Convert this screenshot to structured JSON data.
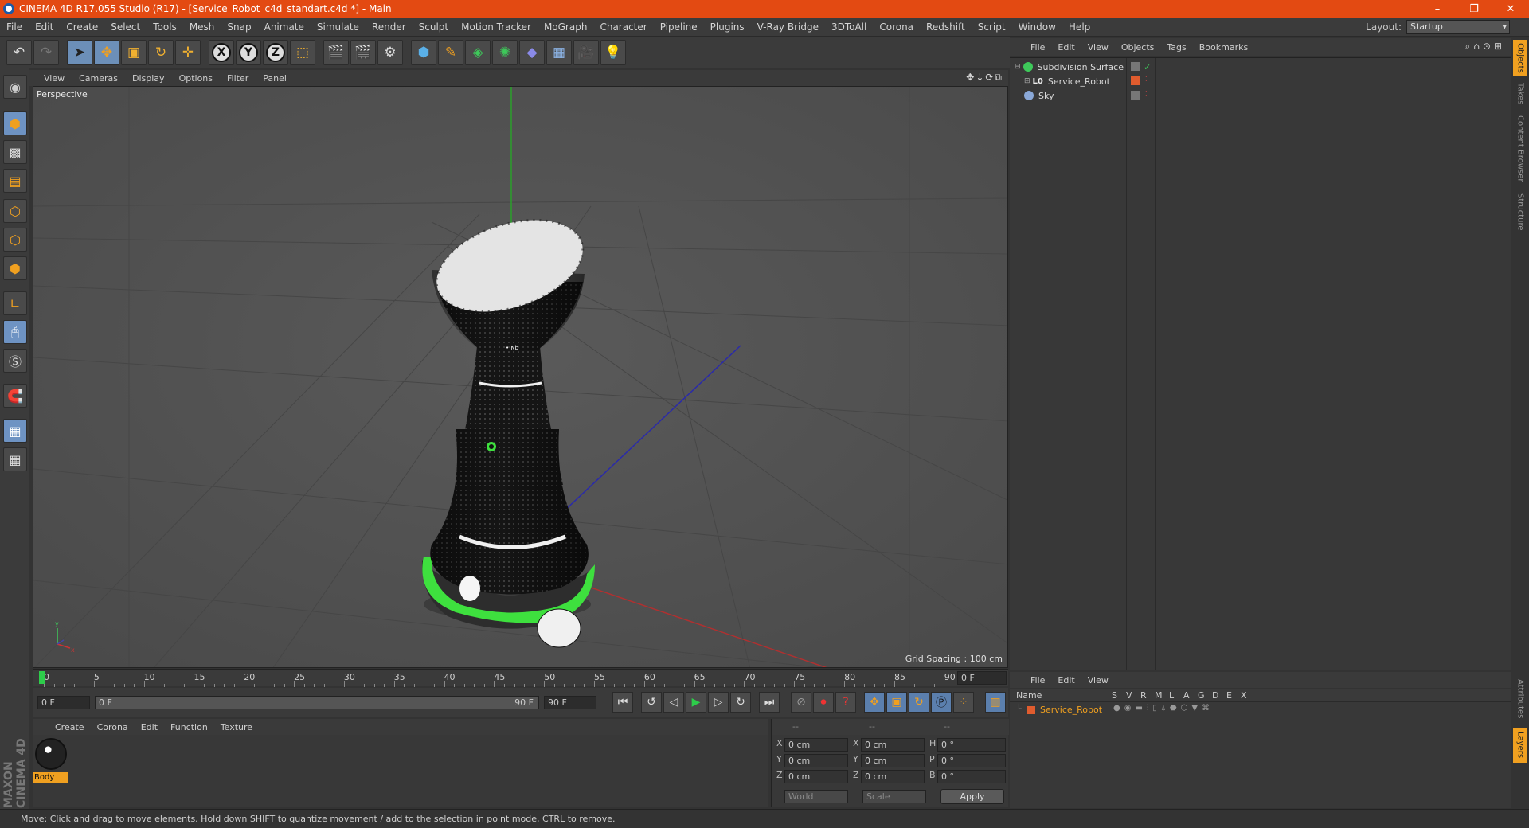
{
  "app": {
    "title": "CINEMA 4D R17.055 Studio (R17) - [Service_Robot_c4d_standart.c4d *] - Main",
    "window_controls": [
      "–",
      "❐",
      "✕"
    ]
  },
  "menubar": {
    "items": [
      "File",
      "Edit",
      "Create",
      "Select",
      "Tools",
      "Mesh",
      "Snap",
      "Animate",
      "Simulate",
      "Render",
      "Sculpt",
      "Motion Tracker",
      "MoGraph",
      "Character",
      "Pipeline",
      "Plugins",
      "V-Ray Bridge",
      "3DToAll",
      "Corona",
      "Redshift",
      "Script",
      "Window",
      "Help"
    ],
    "layout_label": "Layout:",
    "layout_value": "Startup"
  },
  "viewport": {
    "menu": [
      "View",
      "Cameras",
      "Display",
      "Options",
      "Filter",
      "Panel"
    ],
    "label": "Perspective",
    "grid_spacing": "Grid Spacing : 100 cm"
  },
  "timeline": {
    "ticks": [
      "0",
      "5",
      "10",
      "15",
      "20",
      "25",
      "30",
      "35",
      "40",
      "45",
      "50",
      "55",
      "60",
      "65",
      "70",
      "75",
      "80",
      "85",
      "90"
    ],
    "current_frame": "0 F",
    "start_field": "0 F",
    "range_start": "0 F",
    "range_end": "90 F",
    "end_field": "90 F"
  },
  "materials": {
    "menu": [
      "Create",
      "Corona",
      "Edit",
      "Function",
      "Texture"
    ],
    "items": [
      {
        "name": "Body"
      }
    ]
  },
  "coordinates": {
    "headers": [
      "--",
      "--",
      "--"
    ],
    "rows": [
      {
        "a": "X",
        "av": "0 cm",
        "b": "X",
        "bv": "0 cm",
        "c": "H",
        "cv": "0 °"
      },
      {
        "a": "Y",
        "av": "0 cm",
        "b": "Y",
        "bv": "0 cm",
        "c": "P",
        "cv": "0 °"
      },
      {
        "a": "Z",
        "av": "0 cm",
        "b": "Z",
        "bv": "0 cm",
        "c": "B",
        "cv": "0 °"
      }
    ],
    "mode_world": "World",
    "mode_scale": "Scale",
    "apply_label": "Apply"
  },
  "object_manager": {
    "menu": [
      "File",
      "Edit",
      "View",
      "Objects",
      "Tags",
      "Bookmarks"
    ],
    "objects": [
      {
        "name": "Subdivision Surface",
        "icon_color": "#3ec95a"
      },
      {
        "name": "Service_Robot",
        "icon_color": "#e0e0e0"
      },
      {
        "name": "Sky",
        "icon_color": "#8aa8d8"
      }
    ]
  },
  "layers": {
    "menu": [
      "File",
      "Edit",
      "View"
    ],
    "columns": [
      "Name",
      "S",
      "V",
      "R",
      "M",
      "L",
      "A",
      "G",
      "D",
      "E",
      "X"
    ],
    "rows": [
      {
        "name": "Service_Robot",
        "color": "#e05c2e"
      }
    ]
  },
  "right_tabs": [
    "Objects",
    "Takes",
    "Content Browser",
    "Structure"
  ],
  "right_tabs_bottom": [
    "Attributes",
    "Layers"
  ],
  "maxon_logo": "MAXON CINEMA 4D",
  "status": "Move: Click and drag to move elements. Hold down SHIFT to quantize movement / add to the selection in point mode, CTRL to remove.",
  "colors": {
    "titlebar": "#e34a12",
    "accent_orange": "#f0a020",
    "robot_green": "#3ee03e"
  }
}
